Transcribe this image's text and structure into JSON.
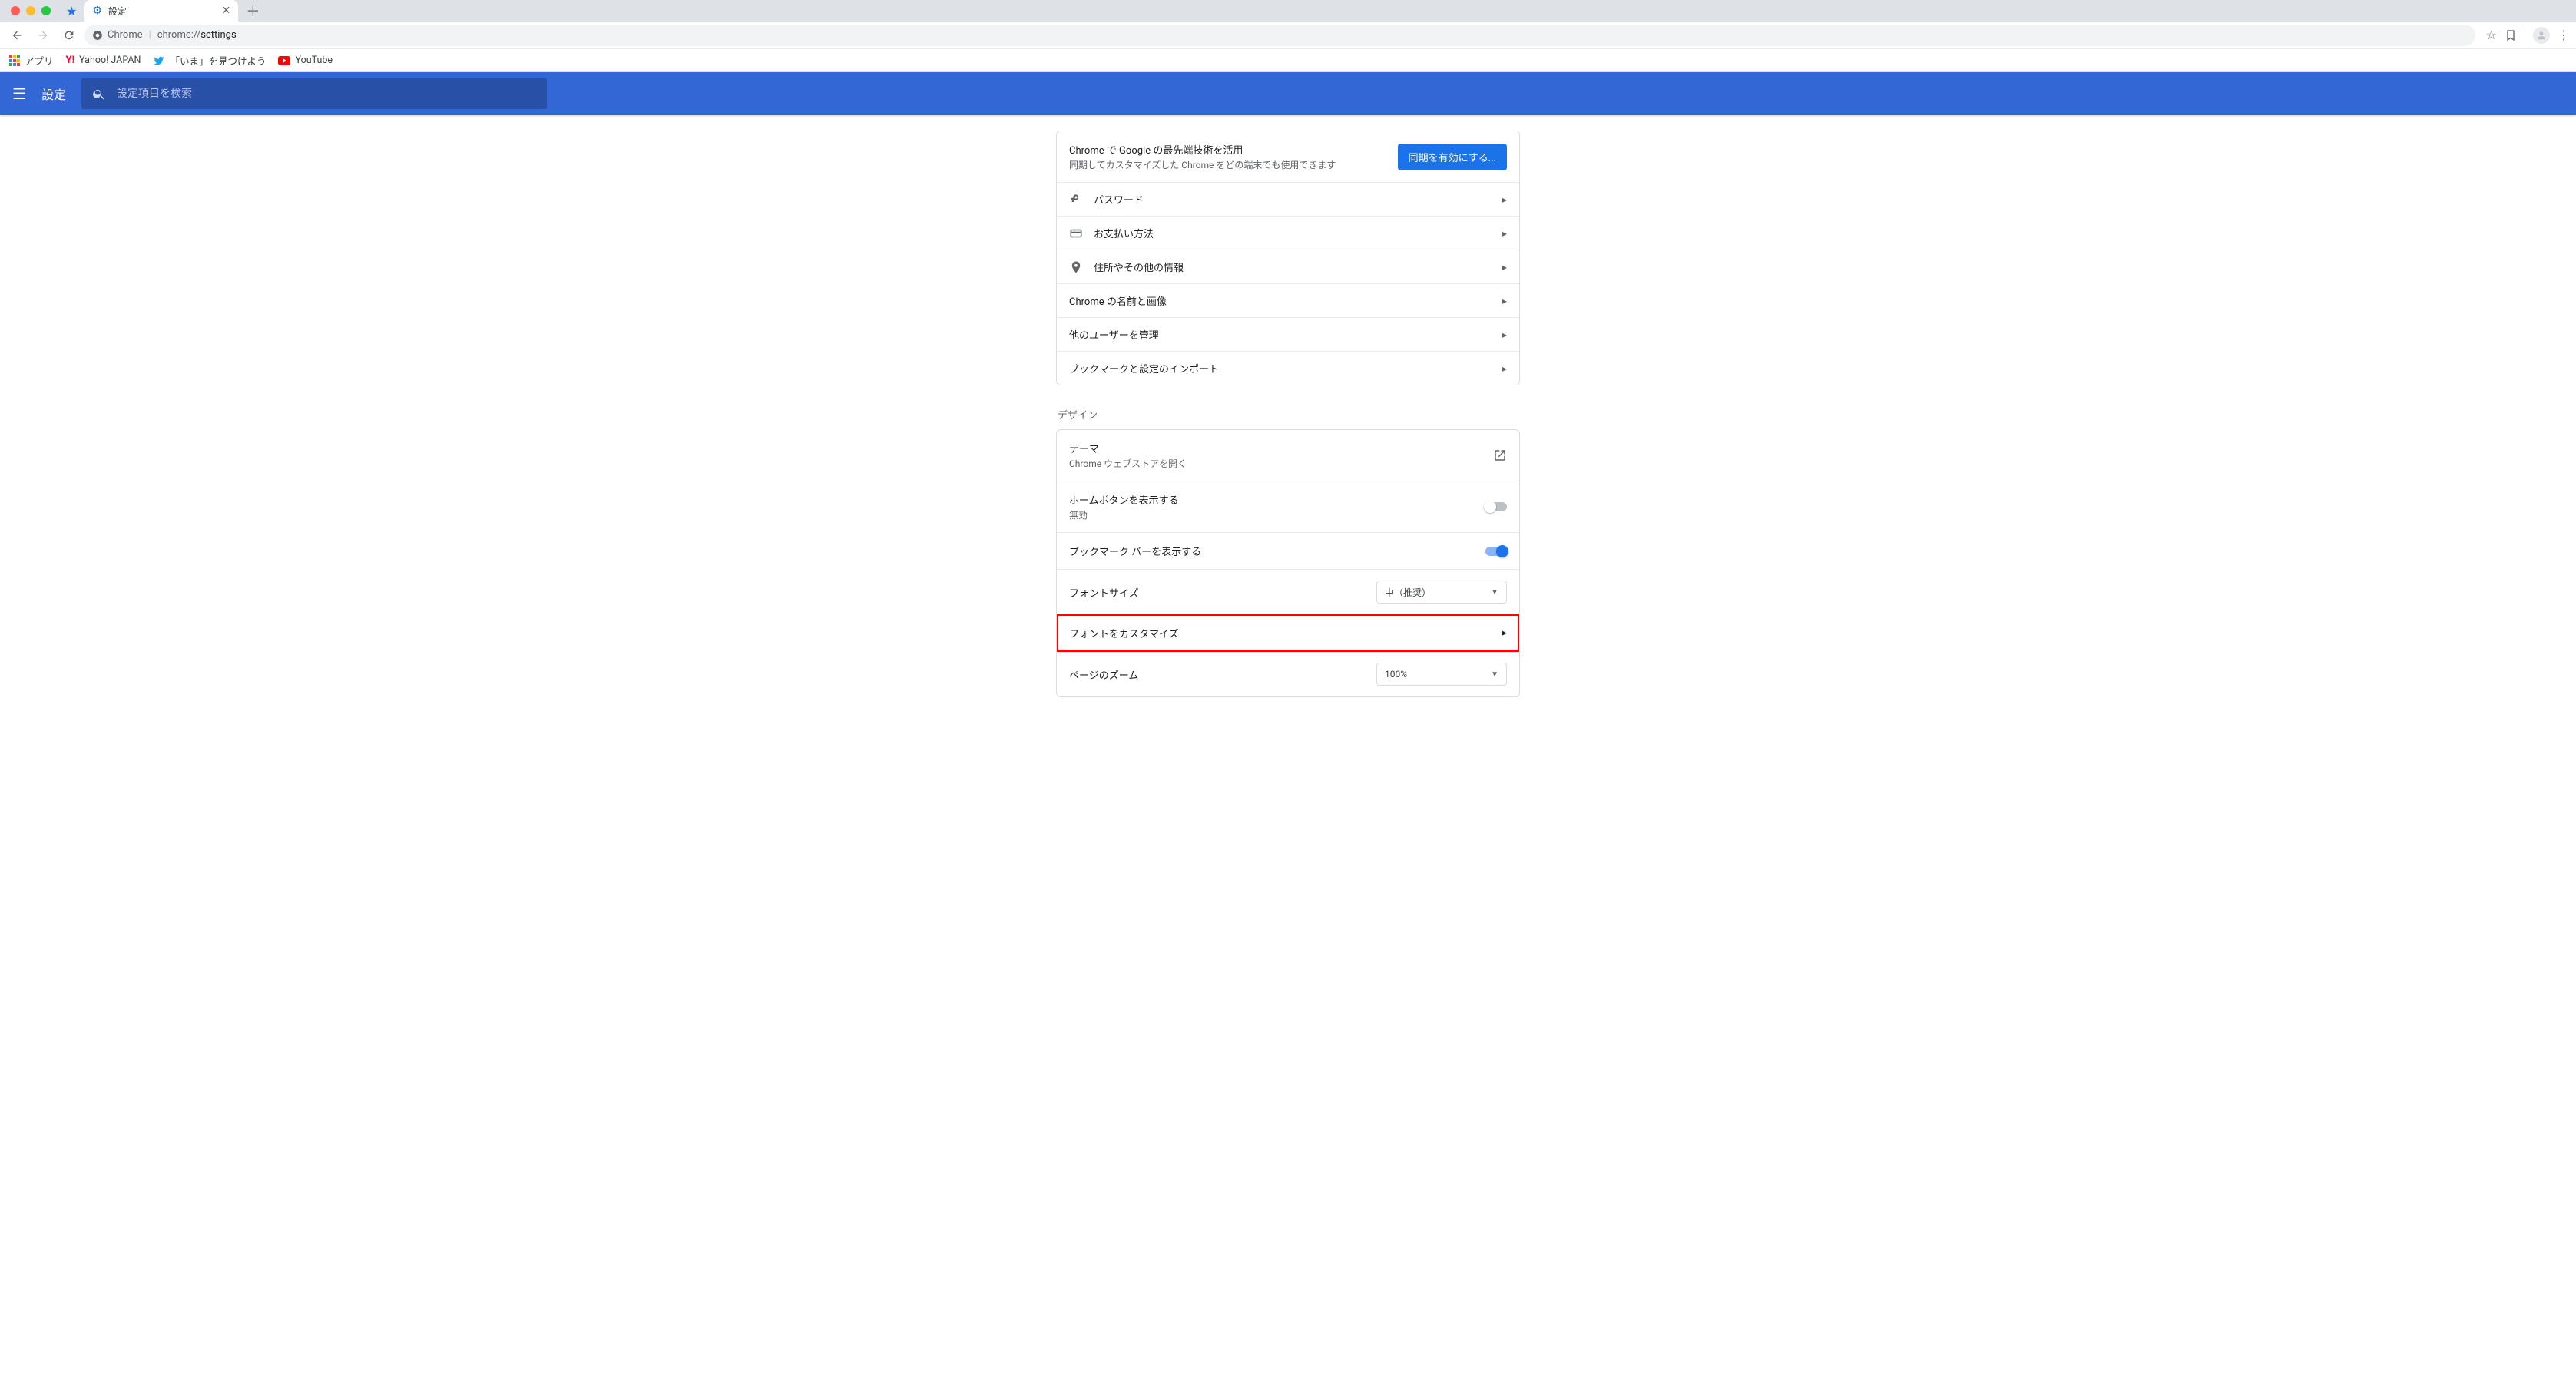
{
  "browser": {
    "tab_title": "設定",
    "omnibox": {
      "chip": "Chrome",
      "url_prefix": "chrome://",
      "url_bold": "settings"
    },
    "bookmarks": {
      "apps": "アプリ",
      "yahoo": "Yahoo! JAPAN",
      "twitter": "「いま」を見つけよう",
      "youtube": "YouTube"
    }
  },
  "header": {
    "title": "設定",
    "search_placeholder": "設定項目を検索"
  },
  "sync": {
    "title": "Chrome で Google の最先端技術を活用",
    "subtitle": "同期してカスタマイズした Chrome をどの端末でも使用できます",
    "button": "同期を有効にする..."
  },
  "people_rows": {
    "passwords": "パスワード",
    "payment": "お支払い方法",
    "addresses": "住所やその他の情報",
    "name_image": "Chrome の名前と画像",
    "manage_users": "他のユーザーを管理",
    "import": "ブックマークと設定のインポート"
  },
  "design": {
    "section": "デザイン",
    "theme": {
      "title": "テーマ",
      "sub": "Chrome ウェブストアを開く"
    },
    "home_button": {
      "title": "ホームボタンを表示する",
      "sub": "無効"
    },
    "show_bookmarks": "ブックマーク バーを表示する",
    "font_size": {
      "label": "フォントサイズ",
      "value": "中（推奨）"
    },
    "customize_fonts": "フォントをカスタマイズ",
    "page_zoom": {
      "label": "ページのズーム",
      "value": "100%"
    }
  }
}
